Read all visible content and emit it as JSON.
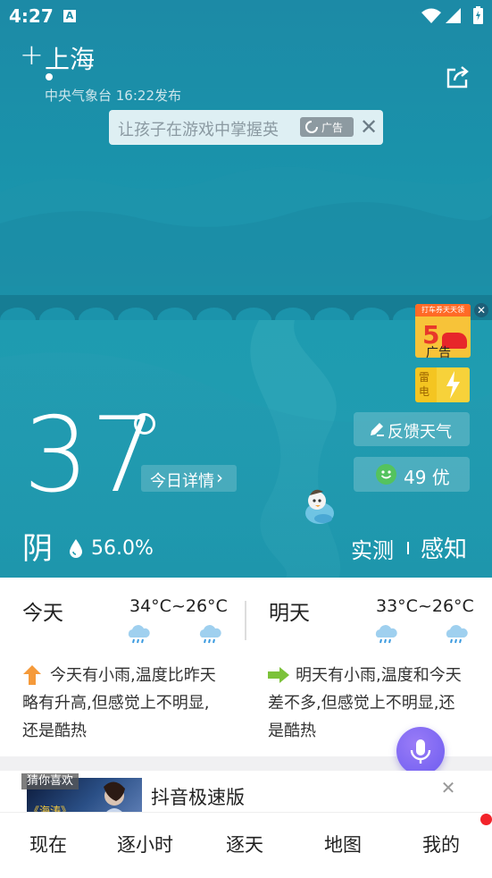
{
  "status_bar": {
    "time": "4:27",
    "notification_icon": "A"
  },
  "header": {
    "add_icon": "+",
    "city": "上海",
    "publish_info": "中央气象台 16:22发布"
  },
  "ad_banner": {
    "text": "让孩子在游戏中掌握英",
    "tag": "广告",
    "close": "✕"
  },
  "side_ads": {
    "top_strip": "打车券天天领",
    "number": "5",
    "label": "广告",
    "thunder": "雷电",
    "close": "✕"
  },
  "current": {
    "temperature": "37",
    "today_detail": "今日详情",
    "feedback": "反馈天气",
    "aqi": "49 优",
    "condition": "阴",
    "humidity": "56.0%",
    "tab_observed": "实测",
    "tab_feel": "感知"
  },
  "forecast": {
    "today": {
      "title": "今天",
      "range": "34°C~26°C",
      "description_lines": [
        "今天有小雨,温度比昨天",
        "略有升高,但感觉上不明显,",
        "还是酷热"
      ]
    },
    "tomorrow": {
      "title": "明天",
      "range": "33°C~26°C",
      "description_lines": [
        "明天有小雨,温度和今天",
        "差不多,但感觉上不明显,还",
        "是酷热"
      ]
    }
  },
  "feed_ad": {
    "tag": "猜你喜欢",
    "thumb_text": "《海涛》",
    "title": "抖音极速版",
    "close": "✕"
  },
  "nav": {
    "items": [
      "现在",
      "逐小时",
      "逐天",
      "地图",
      "我的"
    ]
  },
  "colors": {
    "hero": "#1c8aa6",
    "accent_up": "#f59a3a",
    "accent_right": "#7cc23a",
    "fab": "#7a63f3",
    "badge": "#f2232a"
  }
}
